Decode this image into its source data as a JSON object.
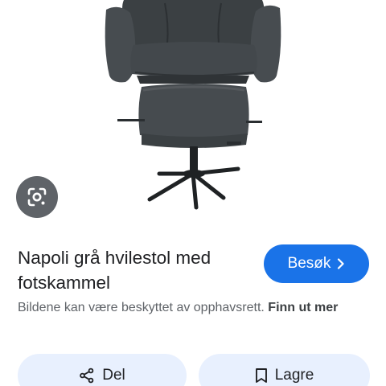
{
  "image": {
    "subject": "grey recliner chair with footstool",
    "lens_icon": "google-lens-icon"
  },
  "result": {
    "title": "Napoli grå hvilestol med fotskammel",
    "visit_button": {
      "label": "Besøk",
      "icon": "chevron-right-icon",
      "color": "#1a73e8"
    },
    "copyright_text": "Bildene kan være beskyttet av opphavsrett.",
    "learn_more_link": "Finn ut mer"
  },
  "actions": {
    "share": {
      "label": "Del",
      "icon": "share-icon"
    },
    "save": {
      "label": "Lagre",
      "icon": "bookmark-icon"
    }
  }
}
